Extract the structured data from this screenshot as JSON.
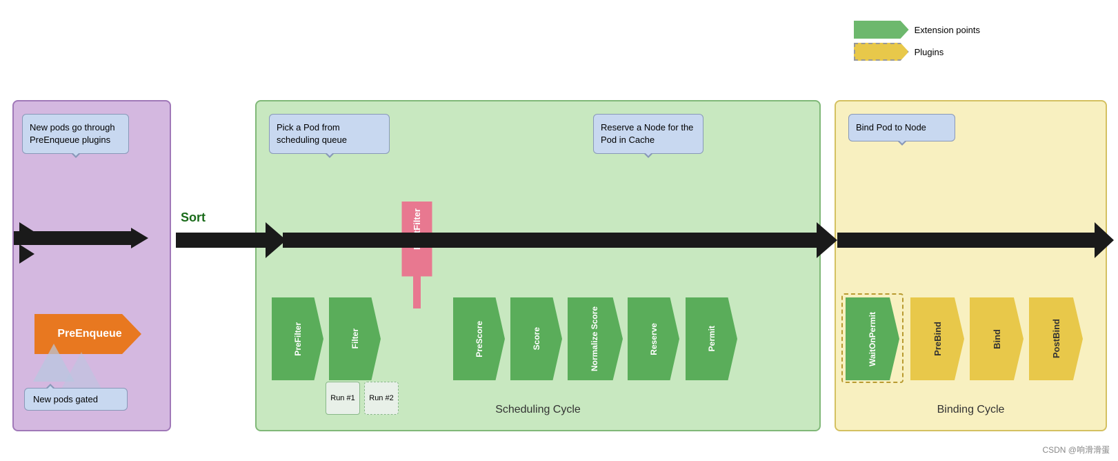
{
  "legend": {
    "extension_points": "Extension points",
    "plugins": "Plugins"
  },
  "preenqueue": {
    "description": "New pods go through PreEnqueue plugins",
    "label": "PreEnqueue",
    "gated_label": "New pods gated"
  },
  "sort": {
    "label": "Sort"
  },
  "scheduling_cycle": {
    "label": "Scheduling Cycle",
    "pick_pod": "Pick a Pod from scheduling queue",
    "reserve_node": "Reserve a Node for the Pod in Cache",
    "postfilter_label": "PostFilter",
    "plugins": [
      {
        "label": "PreFilter"
      },
      {
        "label": "Filter"
      },
      {
        "label": "PreScore"
      },
      {
        "label": "Score"
      },
      {
        "label": "Normalize Score"
      },
      {
        "label": "Reserve"
      },
      {
        "label": "Permit"
      }
    ],
    "run1": "Run #1",
    "run2": "Run #2"
  },
  "binding_cycle": {
    "label": "Binding Cycle",
    "bind_pod": "Bind Pod to Node",
    "plugins": [
      {
        "label": "WaitOnPermit"
      },
      {
        "label": "PreBind"
      },
      {
        "label": "Bind"
      },
      {
        "label": "PostBind"
      }
    ]
  },
  "watermark": "CSDN @响滑滑蛋"
}
